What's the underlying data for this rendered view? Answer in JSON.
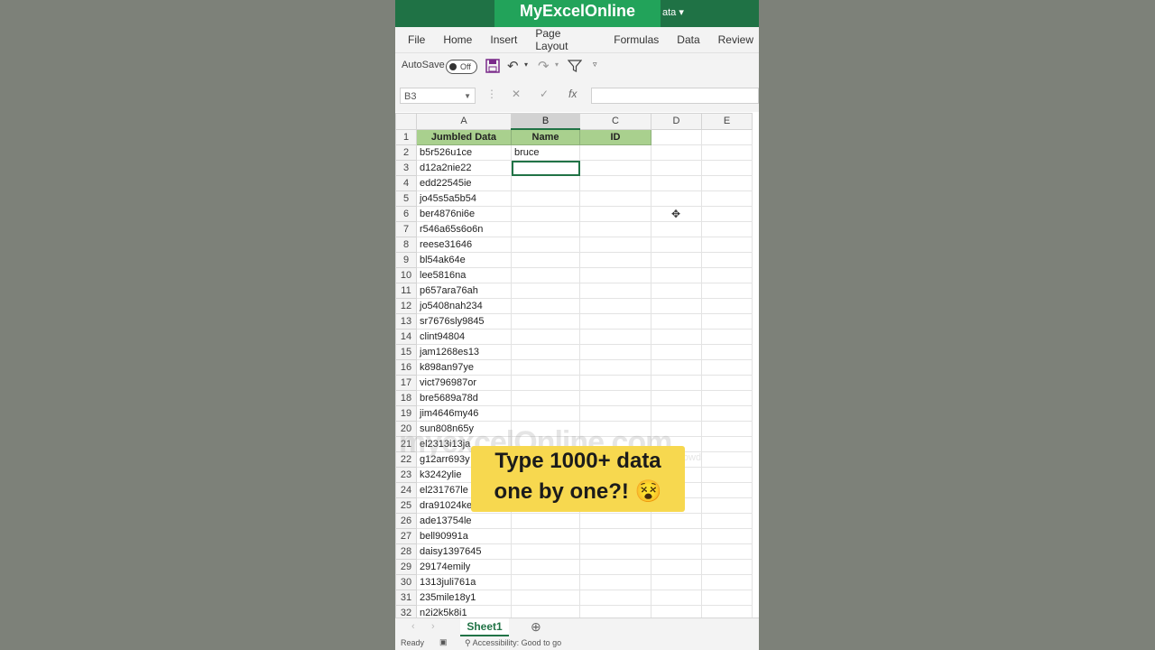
{
  "brand": "MyExcelOnline",
  "title_tail": "ata",
  "menu": [
    "File",
    "Home",
    "Insert",
    "Page Layout",
    "Formulas",
    "Data",
    "Review"
  ],
  "qat": {
    "autosave_label": "AutoSave",
    "autosave_state": "Off"
  },
  "namebox": "B3",
  "columns": [
    "A",
    "B",
    "C",
    "D",
    "E"
  ],
  "headers": {
    "a": "Jumbled Data",
    "b": "Name",
    "c": "ID"
  },
  "b2": "bruce",
  "column_a": [
    "b5r526u1ce",
    "d12a2nie22",
    "edd22545ie",
    "jo45s5a5b54",
    "ber4876ni6e",
    "r546a65s6o6n",
    "reese31646",
    "bl54ak64e",
    "lee5816na",
    "p657ara76ah",
    "jo5408nah234",
    "sr7676sly9845",
    "clint94804",
    "jam1268es13",
    "k898an97ye",
    "vict796987or",
    "bre5689a78d",
    "jim4646my46",
    "sun808n65y",
    "el2313i13ja",
    "g12arr693y",
    "k3242ylie",
    "el231767le",
    "dra91024ke",
    "ade13754le",
    "bell90991a",
    "daisy1397645",
    "29174emily",
    "1313juli761a",
    "235mile18y1",
    "n2i2k5k8i1"
  ],
  "watermark": {
    "text": "myexcelOnline.com",
    "tagline": "stand out from the crowd"
  },
  "callout": {
    "line1": "Type 1000+ data",
    "line2": "one by one?! 😵"
  },
  "sheet_tab": "Sheet1",
  "status": {
    "ready": "Ready",
    "accessibility": "Accessibility: Good to go"
  },
  "colors": {
    "excel_green": "#1f7245",
    "brand_green": "#22a35a",
    "header_fill": "#a9d08e",
    "callout": "#f7d84f",
    "background": "#7d8179"
  }
}
